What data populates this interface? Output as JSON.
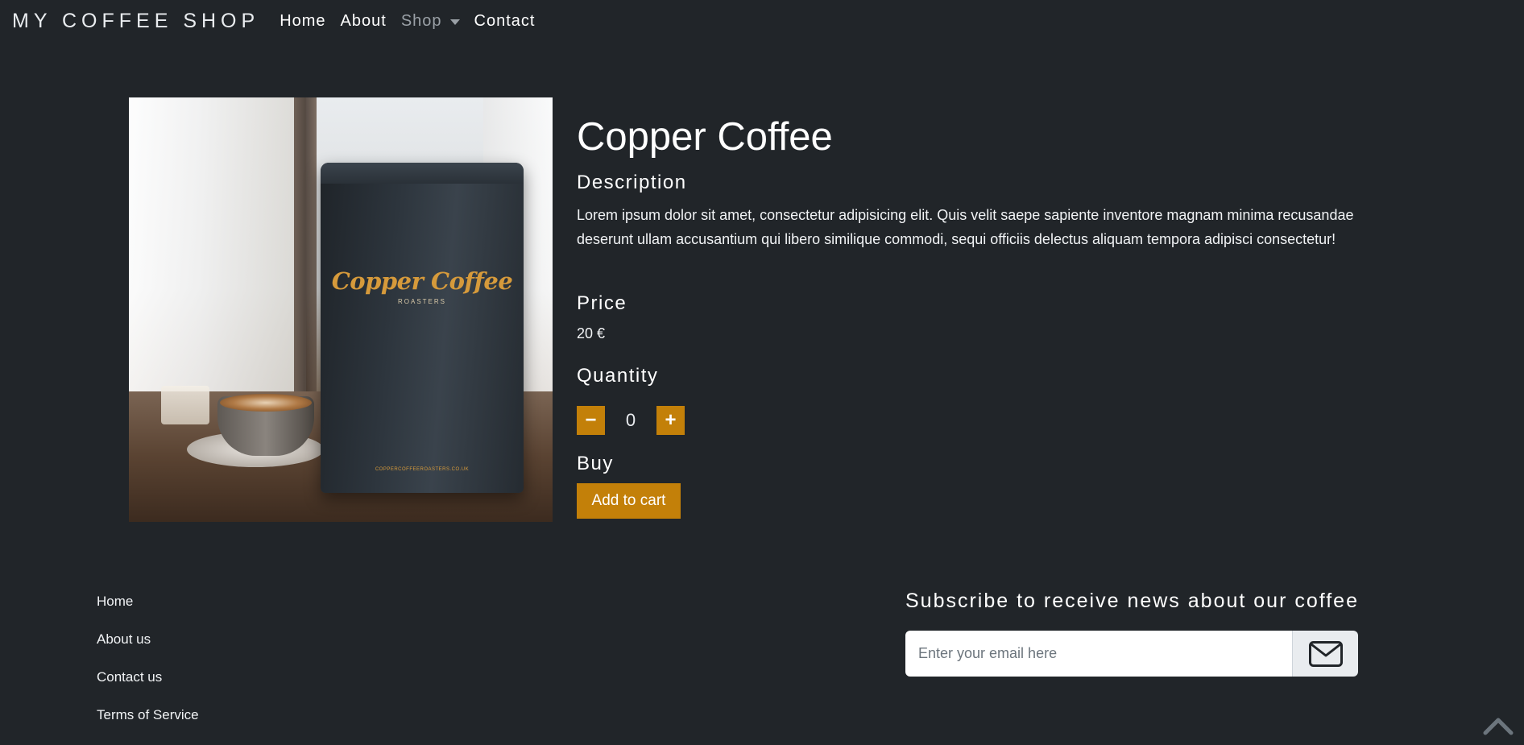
{
  "navbar": {
    "brand": "MY COFFEE SHOP",
    "links": [
      {
        "label": "Home"
      },
      {
        "label": "About"
      },
      {
        "label": "Shop"
      },
      {
        "label": "Contact"
      }
    ]
  },
  "product": {
    "title": "Copper Coffee",
    "image": {
      "bag_logo": "Copper Coffee",
      "bag_subtitle": "ROASTERS",
      "bag_url": "COPPERCOFFEEROASTERS.CO.UK"
    },
    "description_label": "Description",
    "description": "Lorem ipsum dolor sit amet, consectetur adipisicing elit. Quis velit saepe sapiente inventore magnam minima recusandae deserunt ullam accusantium qui libero similique commodi, sequi officiis delectus aliquam tempora adipisci consectetur!",
    "price_label": "Price",
    "price": "20 €",
    "quantity_label": "Quantity",
    "quantity": "0",
    "decrement_symbol": "−",
    "increment_symbol": "+",
    "buy_label": "Buy",
    "add_to_cart": "Add to cart"
  },
  "footer": {
    "links": [
      {
        "label": "Home"
      },
      {
        "label": "About us"
      },
      {
        "label": "Contact us"
      },
      {
        "label": "Terms of Service"
      }
    ],
    "subscribe_title": "Subscribe to receive news about our coffee",
    "email_placeholder": "Enter your email here",
    "subscribe_icon": "envelope-icon",
    "back_to_top_icon": "chevron-up-icon"
  },
  "colors": {
    "background": "#212529",
    "accent": "#c38009",
    "text": "#ffffff",
    "muted_nav": "#9aa0a6"
  }
}
